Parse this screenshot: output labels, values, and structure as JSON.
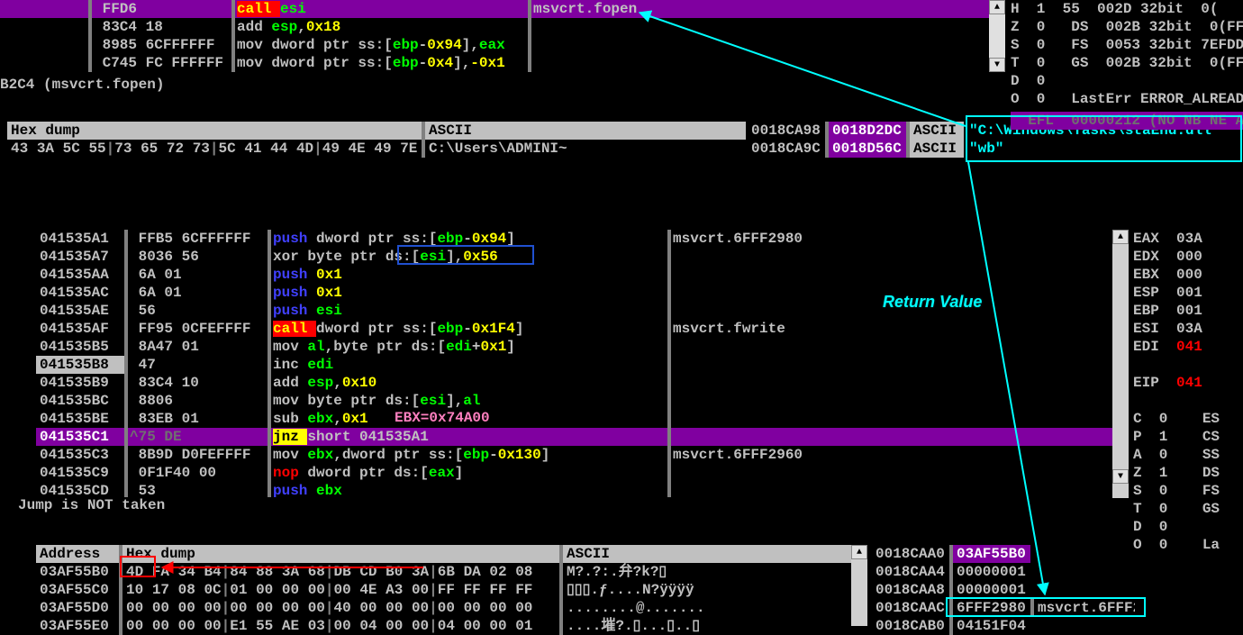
{
  "top_disasm": {
    "rows": [
      {
        "addr": "",
        "bytes": "FFD6",
        "asm": [
          [
            "call ",
            "jmp-hl"
          ],
          [
            "esi",
            "reg"
          ]
        ],
        "cmt": "msvcrt.fopen",
        "hl": true
      },
      {
        "addr": "",
        "bytes": "83C4 18",
        "asm": [
          [
            "add ",
            "op"
          ],
          [
            "esp",
            "reg"
          ],
          [
            ",",
            "p"
          ],
          [
            "0x18",
            "num"
          ]
        ],
        "cmt": ""
      },
      {
        "addr": "",
        "bytes": "8985 6CFFFFFF",
        "asm": [
          [
            "mov ",
            "op"
          ],
          [
            "dword ptr ",
            "type"
          ],
          [
            "ss:",
            "seg"
          ],
          [
            "[",
            "br"
          ],
          [
            "ebp",
            "reg"
          ],
          [
            "-",
            "p"
          ],
          [
            "0x94",
            "num"
          ],
          [
            "]",
            "br"
          ],
          [
            ",",
            "p"
          ],
          [
            "eax",
            "reg"
          ]
        ],
        "cmt": ""
      },
      {
        "addr": "",
        "bytes": "C745 FC FFFFFF",
        "asm": [
          [
            "mov ",
            "op"
          ],
          [
            "dword ptr ",
            "type"
          ],
          [
            "ss:",
            "seg"
          ],
          [
            "[",
            "br"
          ],
          [
            "ebp",
            "reg"
          ],
          [
            "-",
            "p"
          ],
          [
            "0x4",
            "num"
          ],
          [
            "]",
            "br"
          ],
          [
            ",",
            "p"
          ],
          [
            "-0x1",
            "num"
          ]
        ],
        "cmt": ""
      }
    ]
  },
  "top_status": "B2C4 (msvcrt.fopen)",
  "top_hex": {
    "hdr_hex": "Hex dump",
    "hdr_ascii": "ASCII",
    "bytes": [
      "43",
      "3A",
      "5C",
      "55",
      "73",
      "65",
      "72",
      "73",
      "5C",
      "41",
      "44",
      "4D",
      "49",
      "4E",
      "49",
      "7E"
    ],
    "ascii": "C:\\Users\\ADMINI~"
  },
  "top_stack_hdr": {
    "addr": "0018CA98",
    "val": "0018D2DC",
    "tag": "ASCII",
    "str": "\"C:\\Windows\\Tasks\\staEnd.dll\""
  },
  "top_stack_row2": {
    "addr": "0018CA9C",
    "val": "0018D56C",
    "tag": "ASCII",
    "str": "\"wb\""
  },
  "top_regs": [
    "H  1  55  002D 32bit  0(",
    "Z  0   DS  002B 32bit  0(FFFF",
    "S  0   FS  0053 32bit 7EFDD0",
    "T  0   GS  002B 32bit  0(FFFF",
    "D  0",
    "O  0   LastErr ERROR_ALREADY"
  ],
  "bot_disasm": {
    "rows": [
      {
        "addr": "041535A1",
        "mark": "",
        "bytes": "FFB5 6CFFFFFF",
        "asm": [
          [
            "push ",
            "jmp"
          ],
          [
            "dword ptr ",
            "type"
          ],
          [
            "ss:",
            "seg"
          ],
          [
            "[",
            "br"
          ],
          [
            "ebp",
            "reg"
          ],
          [
            "-",
            "p"
          ],
          [
            "0x94",
            "num"
          ],
          [
            "]",
            "br"
          ]
        ],
        "cmt": "msvcrt.6FFF2980"
      },
      {
        "addr": "041535A7",
        "mark": "",
        "bytes": "8036 56",
        "asm": [
          [
            "xor ",
            "op"
          ],
          [
            "byte ptr ",
            "type"
          ],
          [
            "ds:",
            "seg"
          ],
          [
            "[",
            "br"
          ],
          [
            "esi",
            "reg"
          ],
          [
            "]",
            "br"
          ],
          [
            ",",
            "p"
          ],
          [
            "0x56",
            "num"
          ]
        ],
        "cmt": ""
      },
      {
        "addr": "041535AA",
        "mark": "",
        "bytes": "6A 01",
        "asm": [
          [
            "push ",
            "jmp"
          ],
          [
            "0x1",
            "num"
          ]
        ],
        "cmt": ""
      },
      {
        "addr": "041535AC",
        "mark": "",
        "bytes": "6A 01",
        "asm": [
          [
            "push ",
            "jmp"
          ],
          [
            "0x1",
            "num"
          ]
        ],
        "cmt": ""
      },
      {
        "addr": "041535AE",
        "mark": "",
        "bytes": "56",
        "asm": [
          [
            "push ",
            "jmp"
          ],
          [
            "esi",
            "reg"
          ]
        ],
        "cmt": ""
      },
      {
        "addr": "041535AF",
        "mark": "",
        "bytes": "FF95 0CFEFFFF",
        "asm": [
          [
            "call ",
            "call-hl"
          ],
          [
            "dword ptr ",
            "type"
          ],
          [
            "ss:",
            "seg"
          ],
          [
            "[",
            "br"
          ],
          [
            "ebp",
            "reg"
          ],
          [
            "-",
            "p"
          ],
          [
            "0x1F4",
            "num"
          ],
          [
            "]",
            "br"
          ]
        ],
        "cmt": "msvcrt.fwrite"
      },
      {
        "addr": "041535B5",
        "mark": "",
        "bytes": "8A47 01",
        "asm": [
          [
            "mov ",
            "op"
          ],
          [
            "al",
            "reg"
          ],
          [
            ",",
            "p"
          ],
          [
            "byte ptr ",
            "type"
          ],
          [
            "ds:",
            "seg"
          ],
          [
            "[",
            "br"
          ],
          [
            "edi",
            "reg"
          ],
          [
            "+",
            "p"
          ],
          [
            "0x1",
            "num"
          ],
          [
            "]",
            "br"
          ]
        ],
        "cmt": ""
      },
      {
        "addr": "041535B8",
        "mark": "EIP",
        "bytes": "47",
        "asm": [
          [
            "inc ",
            "op"
          ],
          [
            "edi",
            "reg"
          ]
        ],
        "cmt": ""
      },
      {
        "addr": "041535B9",
        "mark": "",
        "bytes": "83C4 10",
        "asm": [
          [
            "add ",
            "op"
          ],
          [
            "esp",
            "reg"
          ],
          [
            ",",
            "p"
          ],
          [
            "0x10",
            "num"
          ]
        ],
        "cmt": ""
      },
      {
        "addr": "041535BC",
        "mark": "",
        "bytes": "8806",
        "asm": [
          [
            "mov ",
            "op"
          ],
          [
            "byte ptr ",
            "type"
          ],
          [
            "ds:",
            "seg"
          ],
          [
            "[",
            "br"
          ],
          [
            "esi",
            "reg"
          ],
          [
            "]",
            "br"
          ],
          [
            ",",
            "p"
          ],
          [
            "al",
            "reg"
          ]
        ],
        "cmt": ""
      },
      {
        "addr": "041535BE",
        "mark": "",
        "bytes": "83EB 01",
        "asm": [
          [
            "sub ",
            "op"
          ],
          [
            "ebx",
            "reg"
          ],
          [
            ",",
            "p"
          ],
          [
            "0x1",
            "num"
          ]
        ],
        "cmt": ""
      },
      {
        "addr": "041535C1",
        "mark": "^",
        "bytes": "75 DE",
        "asm": [
          [
            "jnz ",
            "jnz"
          ],
          [
            "short 041535A1",
            "tgt"
          ]
        ],
        "cmt": "",
        "hl": true
      },
      {
        "addr": "041535C3",
        "mark": "",
        "bytes": "8B9D D0FEFFFF",
        "asm": [
          [
            "mov ",
            "op"
          ],
          [
            "ebx",
            "reg"
          ],
          [
            ",",
            "p"
          ],
          [
            "dword ptr ",
            "type"
          ],
          [
            "ss:",
            "seg"
          ],
          [
            "[",
            "br"
          ],
          [
            "ebp",
            "reg"
          ],
          [
            "-",
            "p"
          ],
          [
            "0x130",
            "num"
          ],
          [
            "]",
            "br"
          ]
        ],
        "cmt": "msvcrt.6FFF2960"
      },
      {
        "addr": "041535C9",
        "mark": "",
        "bytes": "0F1F40 00",
        "asm": [
          [
            "nop ",
            "nop"
          ],
          [
            "dword ptr ",
            "type"
          ],
          [
            "ds:",
            "seg"
          ],
          [
            "[",
            "br"
          ],
          [
            "eax",
            "reg"
          ],
          [
            "]",
            "br"
          ]
        ],
        "cmt": ""
      },
      {
        "addr": "041535CD",
        "mark": "",
        "bytes": "53",
        "asm": [
          [
            "push ",
            "jmp"
          ],
          [
            "ebx",
            "reg"
          ]
        ],
        "cmt": ""
      }
    ]
  },
  "bot_status": "Jump is NOT taken",
  "bot_hex": {
    "hdr_addr": "Address",
    "hdr_hex": "Hex dump",
    "hdr_ascii": "ASCII",
    "rows": [
      {
        "addr": "03AF55B0",
        "bytes": [
          "4D",
          "FA",
          "34",
          "B4",
          "84",
          "88",
          "3A",
          "68",
          "DB",
          "CD",
          "B0",
          "3A",
          "6B",
          "DA",
          "02",
          "08"
        ],
        "ascii": "M?.?:.弁?k?▯"
      },
      {
        "addr": "03AF55C0",
        "bytes": [
          "10",
          "17",
          "08",
          "0C",
          "01",
          "00",
          "00",
          "00",
          "00",
          "4E",
          "A3",
          "00",
          "FF",
          "FF",
          "FF",
          "FF"
        ],
        "ascii": "▯▯▯.ƒ....N?ÿÿÿÿ"
      },
      {
        "addr": "03AF55D0",
        "bytes": [
          "00",
          "00",
          "00",
          "00",
          "00",
          "00",
          "00",
          "00",
          "40",
          "00",
          "00",
          "00",
          "00",
          "00",
          "00",
          "00"
        ],
        "ascii": "........@......."
      },
      {
        "addr": "03AF55E0",
        "bytes": [
          "00",
          "00",
          "00",
          "00",
          "E1",
          "55",
          "AE",
          "03",
          "00",
          "04",
          "00",
          "00",
          "04",
          "00",
          "00",
          "01"
        ],
        "ascii": "....墔?.▯...▯..▯"
      }
    ]
  },
  "bot_stack": {
    "rows": [
      {
        "addr": "0018CAA0",
        "val": "03AF55B0",
        "hlval": true
      },
      {
        "addr": "0018CAA4",
        "val": "00000001"
      },
      {
        "addr": "0018CAA8",
        "val": "00000001"
      },
      {
        "addr": "0018CAAC",
        "val": "6FFF2980",
        "cmt": "msvcrt.6FFF2980"
      },
      {
        "addr": "0018CAB0",
        "val": "04151F04"
      }
    ]
  },
  "bot_regs": [
    "EAX  03A",
    "EDX  000",
    "EBX  000",
    "ESP  001",
    "EBP  001",
    "ESI  03A",
    "EDI  041",
    "",
    "EIP  041",
    "",
    "C  0    ES",
    "P  1    CS",
    "A  0    SS",
    "Z  1    DS",
    "S  0    FS",
    "T  0    GS",
    "D  0",
    "O  0    La"
  ],
  "annot": {
    "return_value": "Return Value",
    "ebx": "EBX=0x74A00"
  }
}
